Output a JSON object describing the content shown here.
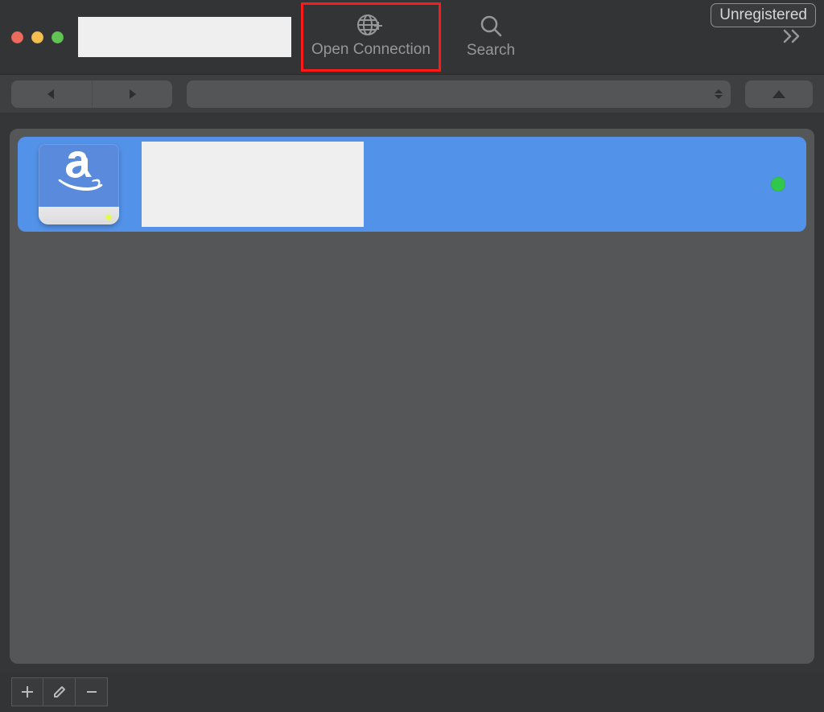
{
  "toolbar": {
    "open_connection_label": "Open Connection",
    "search_label": "Search",
    "unregistered_badge": "Unregistered"
  },
  "bookmarks": {
    "items": [
      {
        "icon": "amazon-drive-icon",
        "name": "",
        "status": "online"
      }
    ]
  },
  "bottom": {
    "add_tooltip": "Add",
    "edit_tooltip": "Edit",
    "remove_tooltip": "Remove"
  }
}
